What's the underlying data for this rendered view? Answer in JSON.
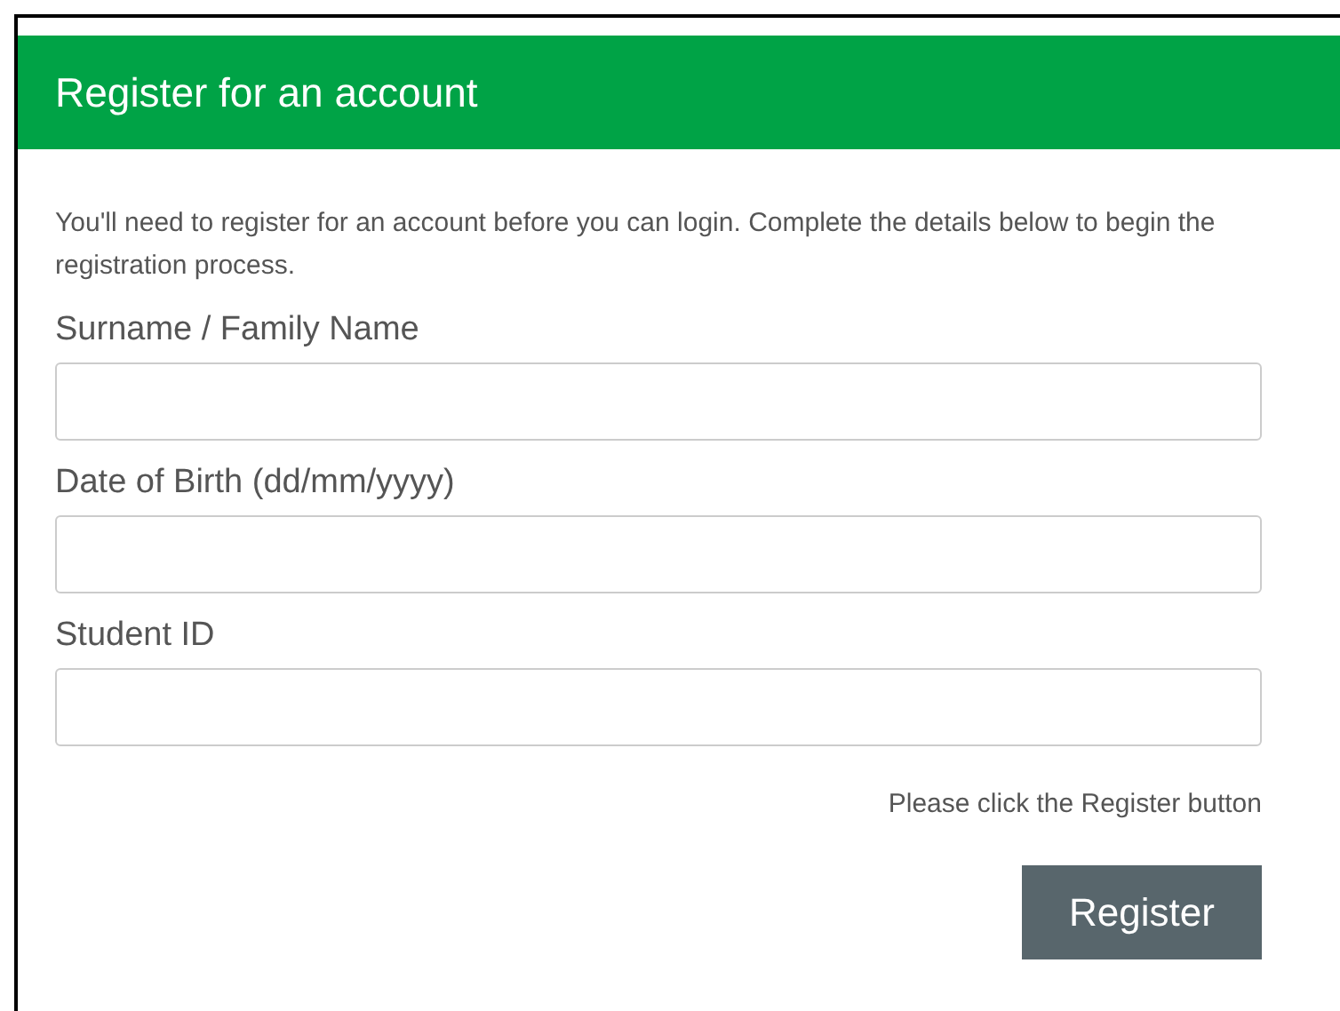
{
  "header": {
    "title": "Register for an account"
  },
  "intro": "You'll need to register for an account before you can login. Complete the details below to begin the registration process.",
  "fields": [
    {
      "label": "Surname / Family Name"
    },
    {
      "label": "Date of Birth (dd/mm/yyyy)"
    },
    {
      "label": "Student ID"
    }
  ],
  "hint": "Please click the Register button",
  "submit_button": "Register"
}
